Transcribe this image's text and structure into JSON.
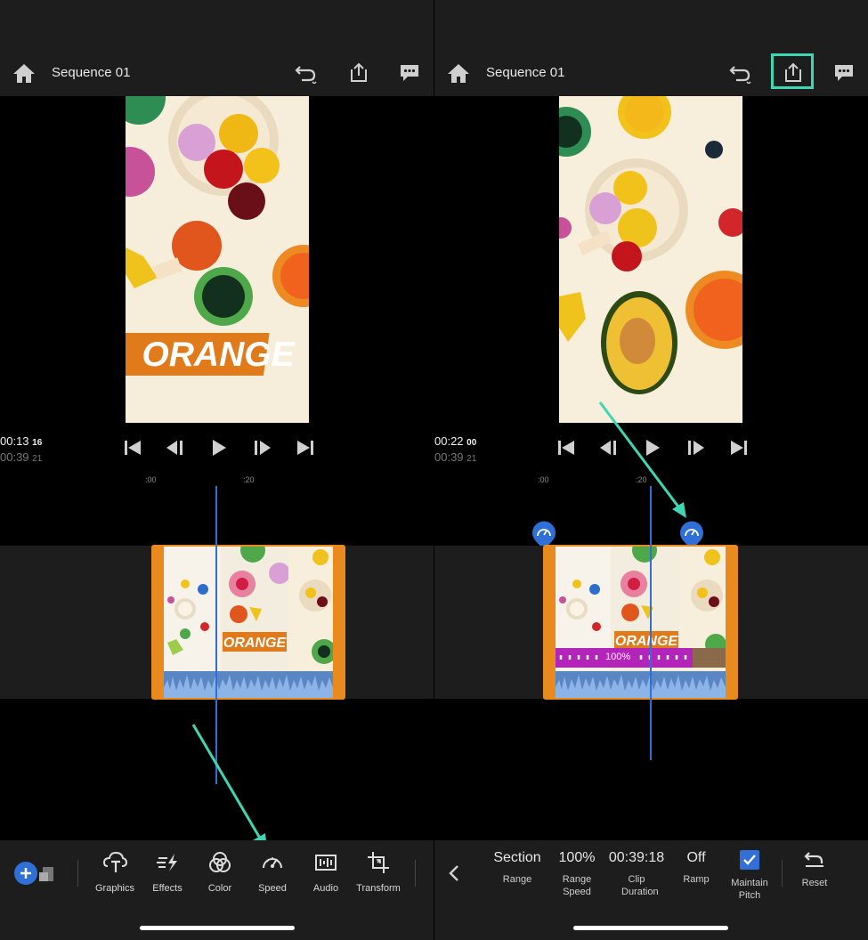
{
  "left": {
    "sequence_title": "Sequence 01",
    "overlay_text": "ORANGE",
    "clip_overlay_text": "ORANGE",
    "timecode": {
      "current": "00:13",
      "current_frames": "16",
      "total": "00:39",
      "total_frames": "21"
    },
    "ruler": [
      "00",
      ":20"
    ],
    "toolbar": [
      {
        "label": "Graphics",
        "icon": "graphics-icon"
      },
      {
        "label": "Effects",
        "icon": "effects-icon"
      },
      {
        "label": "Color",
        "icon": "color-icon"
      },
      {
        "label": "Speed",
        "icon": "speed-icon"
      },
      {
        "label": "Audio",
        "icon": "audio-icon"
      },
      {
        "label": "Transform",
        "icon": "transform-icon"
      }
    ]
  },
  "right": {
    "sequence_title": "Sequence 01",
    "clip_overlay_text": "ORANGE",
    "timecode": {
      "current": "00:22",
      "current_frames": "00",
      "total": "00:39",
      "total_frames": "21"
    },
    "ruler": [
      "00",
      ":20"
    ],
    "speed_label": "100%",
    "properties": [
      {
        "value": "Section",
        "label": "Range"
      },
      {
        "value": "100%",
        "label": "Range Speed"
      },
      {
        "value": "00:39:18",
        "label": "Clip Duration"
      },
      {
        "value": "Off",
        "label": "Ramp"
      },
      {
        "value": "",
        "label": "Maintain Pitch",
        "checked": true
      },
      {
        "value": "",
        "label": "Reset"
      }
    ]
  },
  "colors": {
    "accent": "#2f6fd6",
    "clip": "#e88a1e",
    "highlight": "#3fd6b3",
    "speed": "#b225b8"
  }
}
